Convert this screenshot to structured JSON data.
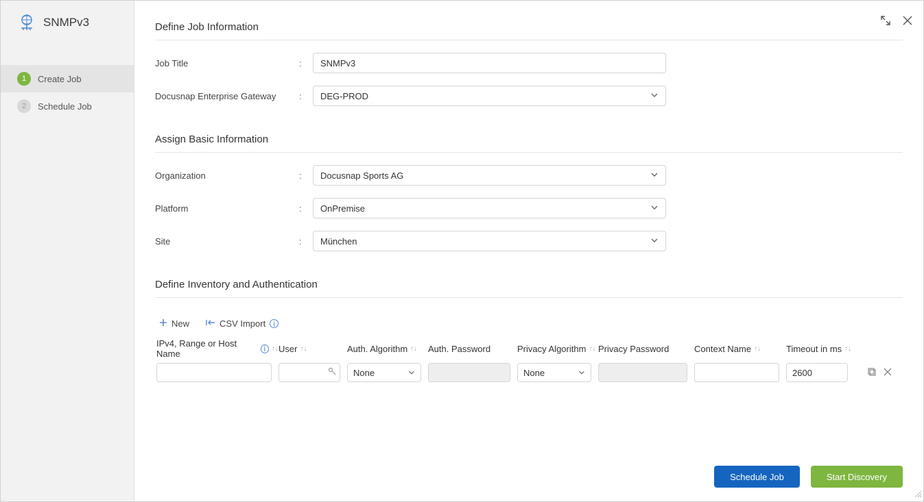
{
  "sidebar": {
    "title": "SNMPv3",
    "steps": [
      {
        "num": "1",
        "label": "Create Job",
        "active": true
      },
      {
        "num": "2",
        "label": "Schedule Job",
        "active": false
      }
    ]
  },
  "sections": {
    "define_job": "Define Job Information",
    "assign_basic": "Assign Basic Information",
    "inventory": "Define Inventory and Authentication"
  },
  "form": {
    "job_title": {
      "label": "Job Title",
      "value": "SNMPv3"
    },
    "gateway": {
      "label": "Docusnap Enterprise Gateway",
      "value": "DEG-PROD"
    },
    "organization": {
      "label": "Organization",
      "value": "Docusnap Sports AG"
    },
    "platform": {
      "label": "Platform",
      "value": "OnPremise"
    },
    "site": {
      "label": "Site",
      "value": "München"
    }
  },
  "inv_toolbar": {
    "new": "New",
    "csv": "CSV Import"
  },
  "grid": {
    "headers": {
      "ipv4": "IPv4, Range or Host Name",
      "user": "User",
      "auth_alg": "Auth. Algorithm",
      "auth_pw": "Auth. Password",
      "priv_alg": "Privacy Algorithm",
      "priv_pw": "Privacy Password",
      "ctx": "Context Name",
      "timeout": "Timeout in ms"
    },
    "row": {
      "ipv4": "",
      "user": "",
      "auth_alg": "None",
      "auth_pw": "",
      "priv_alg": "None",
      "priv_pw": "",
      "ctx": "",
      "timeout": "2600"
    }
  },
  "footer": {
    "schedule": "Schedule Job",
    "start": "Start Discovery"
  }
}
